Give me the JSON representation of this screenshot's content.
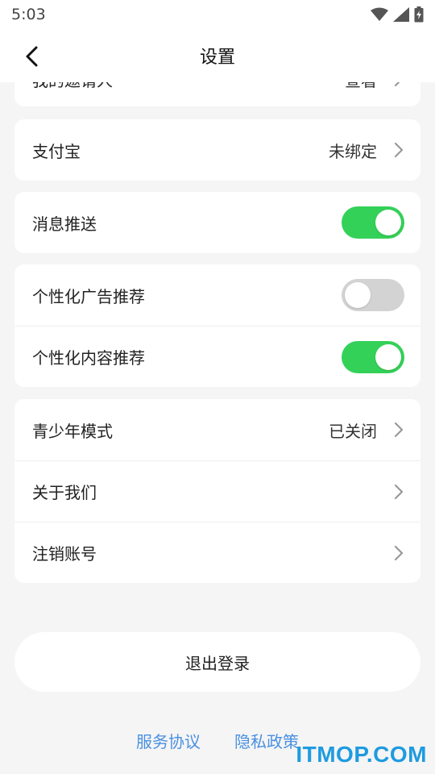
{
  "status_bar": {
    "time": "5:03"
  },
  "header": {
    "title": "设置"
  },
  "sections": {
    "partial_row": {
      "label": "我的邀请人",
      "value": "查看"
    },
    "alipay": {
      "label": "支付宝",
      "value": "未绑定"
    },
    "push": {
      "label": "消息推送",
      "enabled": true
    },
    "personalized_ad": {
      "label": "个性化广告推荐",
      "enabled": false
    },
    "personalized_content": {
      "label": "个性化内容推荐",
      "enabled": true
    },
    "teen_mode": {
      "label": "青少年模式",
      "value": "已关闭"
    },
    "about": {
      "label": "关于我们"
    },
    "delete_account": {
      "label": "注销账号"
    }
  },
  "logout": {
    "label": "退出登录"
  },
  "footer": {
    "service_agreement": "服务协议",
    "privacy_policy": "隐私政策"
  },
  "watermark": {
    "text": "ITMOP.COM"
  },
  "colors": {
    "toggle_on": "#34d158",
    "toggle_off": "#d3d3d3",
    "link": "#4a90e2",
    "background": "#f5f5f5"
  },
  "icons": [
    "back-arrow-icon",
    "chevron-right-icon",
    "wifi-icon",
    "signal-icon",
    "battery-charging-icon"
  ]
}
